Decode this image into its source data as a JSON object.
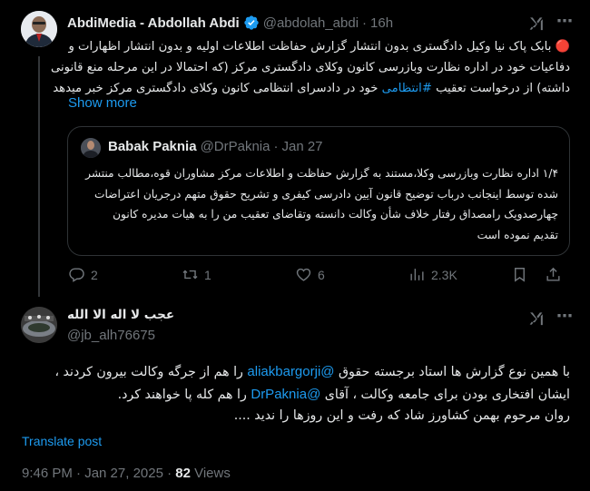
{
  "tweet": {
    "author_name": "AbdiMedia - Abdollah Abdi",
    "handle": "@abdolah_abdi",
    "separator": "·",
    "time": "16h",
    "text_line1": "🔴 بابک پاک نیا وکیل دادگستری بدون انتشار گزارش حفاظت اطلاعات اولیه و بدون انتشار اظهارات و",
    "text_line2": "دفاعیات خود در اداره نظارت وبازرسی کانون وکلای دادگستری مرکز (که احتمالا در این مرحله منع قانونی",
    "text_line3_pre": "داشته) از درخواست تعقیب ",
    "text_line3_hashtag": "#انتظامی",
    "text_line3_post": " خود در دادسرای انتظامی کانون وکلای دادگستری مرکز خبر میدهد",
    "show_more": "Show more",
    "quote": {
      "author_name": "Babak Paknia",
      "handle": "@DrPaknia",
      "separator": "·",
      "date": "Jan 27",
      "line1": "۱/۴ اداره نظارت وبازرسی وکلا،مستند به گزارش حفاظت و اطلاعات مرکز مشاوران قوه،مطالب منتشر",
      "line2": "شده توسط اینجانب درباب توضیح قانون آیین دادرسی کیفری و تشریح حقوق متهم درجریان اعتراضات",
      "line3": "چهارصدویک رامصداق رفتار خلاف شأن وکالت دانسته وتقاضای تعقیب من را به هیات مدیره کانون",
      "line4": "تقدیم نموده است"
    },
    "actions": {
      "replies": "2",
      "retweets": "1",
      "likes": "6",
      "views": "2.3K"
    }
  },
  "reply": {
    "author_name": "عجب لا اله الا الله",
    "handle": "@jb_alh76675",
    "line1_pre": "با همین نوع گزارش ها استاد برجسته حقوق ",
    "line1_mention": "@aliakbargorji",
    "line1_post": " را هم از جرگه وکالت بیرون کردند ،",
    "line2_pre": "ایشان  افتخاری بودن برای جامعه وکالت ، آقای ",
    "line2_mention": "@DrPaknia",
    "line2_post": " را هم کله پا خواهند کرد.",
    "line3": "روان مرحوم بهمن کشاورز شاد که رفت و این روزها را ندید ....",
    "translate": "Translate post",
    "timestamp": "9:46 PM · Jan 27, 2025 · ",
    "views_count": "82",
    "views_label": " Views"
  },
  "colors": {
    "background": "#000000",
    "text": "#e7e9ea",
    "muted": "#71767b",
    "link": "#1d9bf0",
    "verified": "#1d9bf0",
    "border": "#2f3336"
  },
  "icons": [
    "verified-badge-icon",
    "grok-icon",
    "more-icon",
    "reply-icon",
    "retweet-icon",
    "like-icon",
    "views-icon",
    "bookmark-icon",
    "share-icon"
  ]
}
